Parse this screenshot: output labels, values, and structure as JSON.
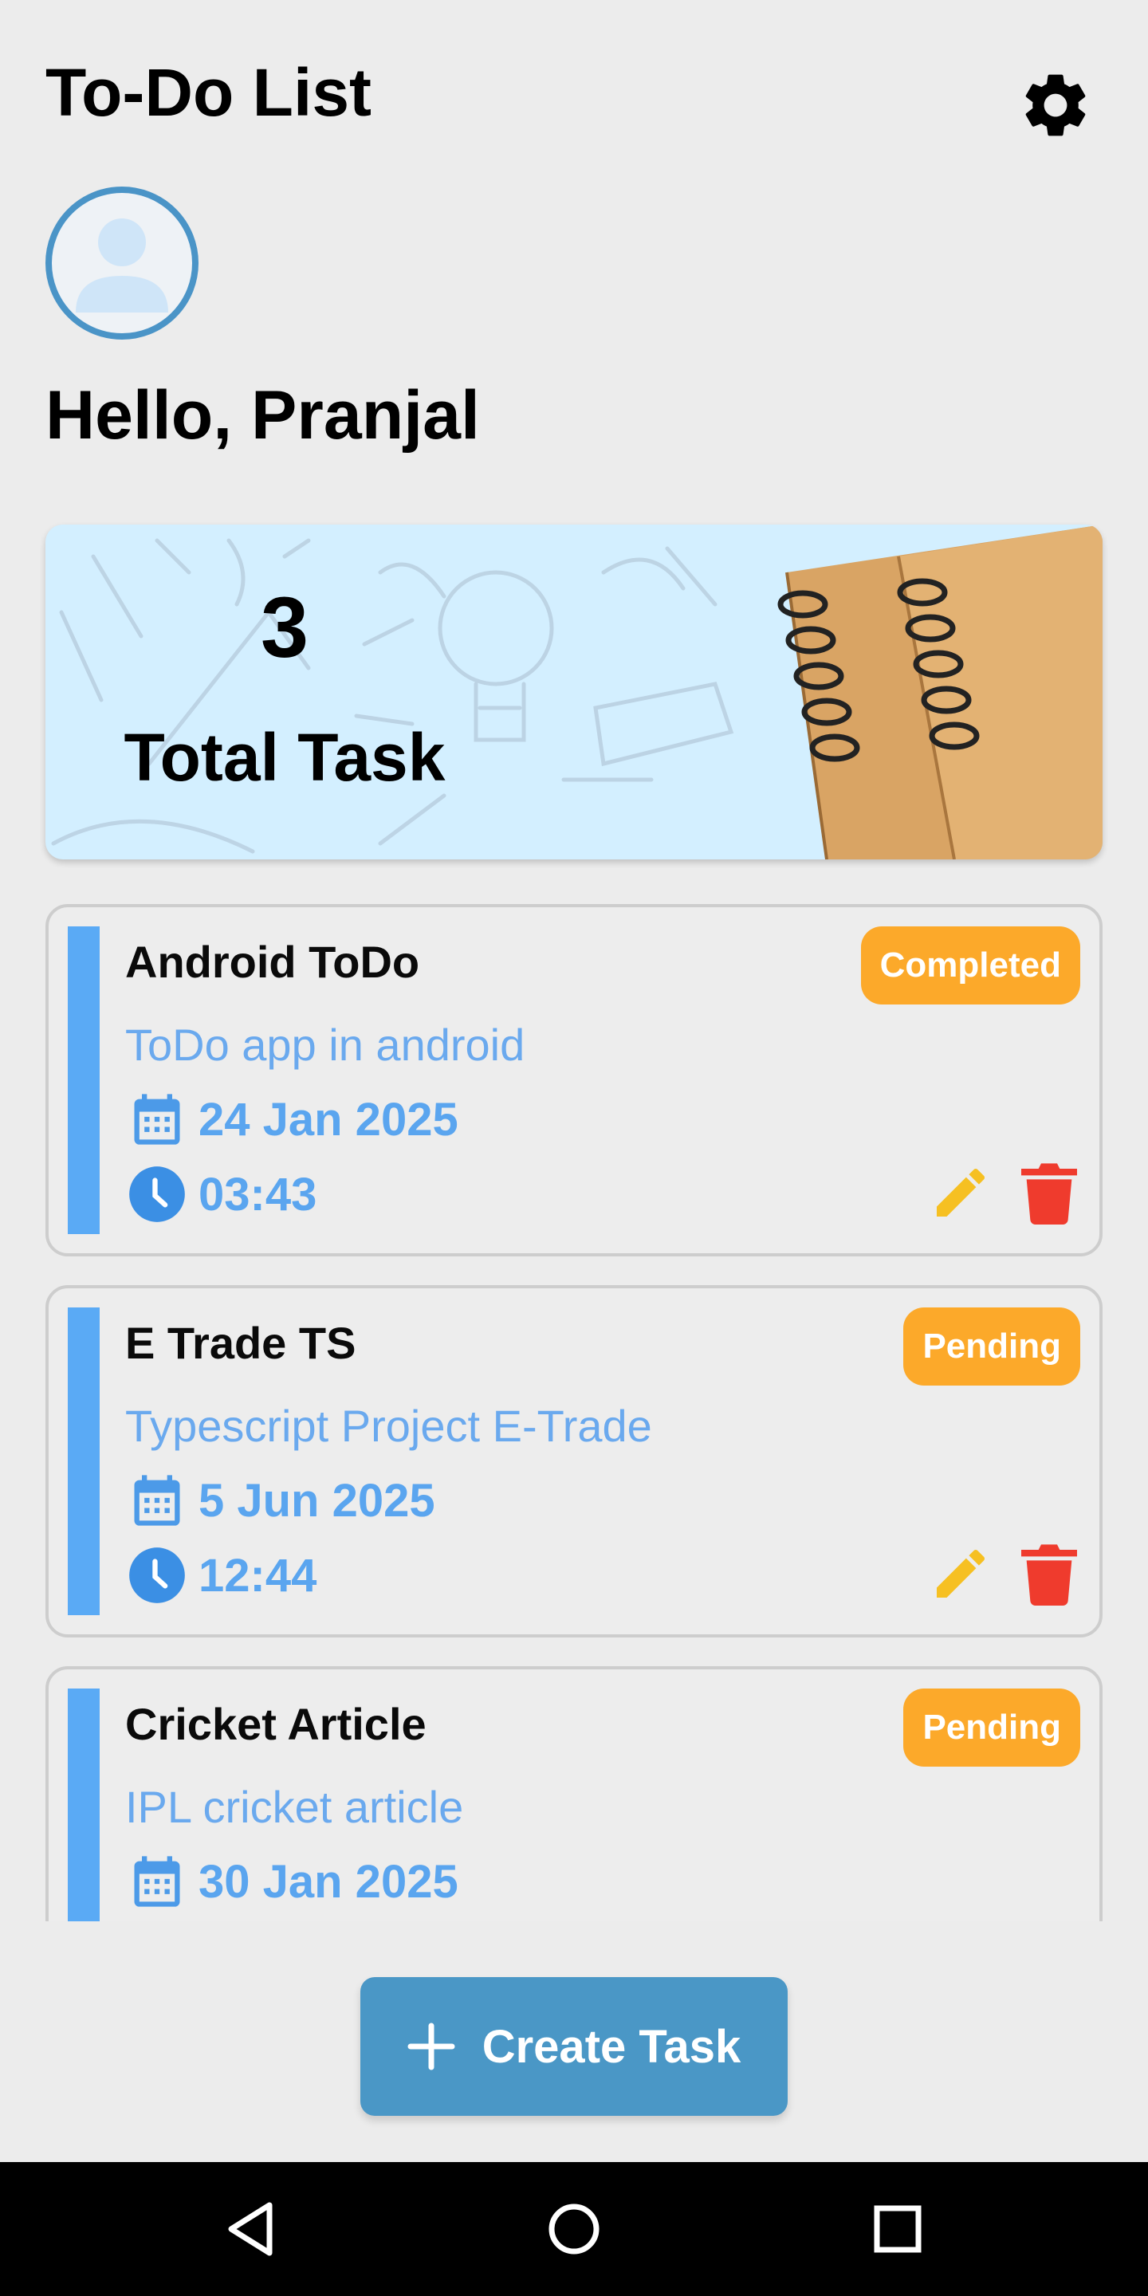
{
  "header": {
    "title": "To-Do List",
    "settings_icon": "gear-icon"
  },
  "greeting": "Hello, Pranjal",
  "summary": {
    "count": "3",
    "label": "Total Task"
  },
  "tasks": [
    {
      "title": "Android ToDo",
      "description": "ToDo app in android",
      "date": "24 Jan 2025",
      "time": "03:43",
      "status": "Completed"
    },
    {
      "title": "E Trade TS",
      "description": "Typescript Project E-Trade",
      "date": "5 Jun 2025",
      "time": "12:44",
      "status": "Pending"
    },
    {
      "title": "Cricket Article",
      "description": "IPL cricket article",
      "date": "30 Jan 2025",
      "time": "",
      "status": "Pending"
    }
  ],
  "create_button": {
    "label": "Create Task",
    "icon": "plus-icon"
  },
  "colors": {
    "accent_blue": "#4a97c6",
    "stripe_blue": "#5aaaf5",
    "status_orange": "#fca92a",
    "edit_yellow": "#f6c022",
    "delete_red": "#ef3b2d"
  }
}
